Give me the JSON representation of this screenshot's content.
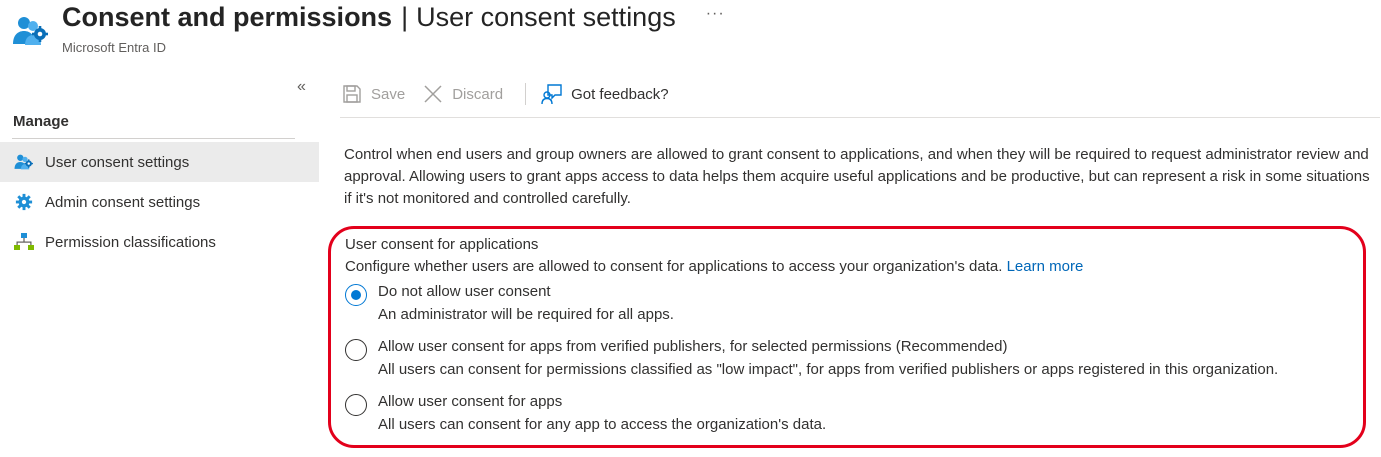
{
  "header": {
    "title_main": "Consent and permissions",
    "title_separator": "|",
    "title_sub": "User consent settings",
    "more": "···",
    "subtitle": "Microsoft Entra ID",
    "icon": "users-gear-icon"
  },
  "sidebar": {
    "collapse": "«",
    "manage_heading": "Manage",
    "items": [
      {
        "label": "User consent settings",
        "icon": "users-gear-icon",
        "active": true
      },
      {
        "label": "Admin consent settings",
        "icon": "gear-icon",
        "active": false
      },
      {
        "label": "Permission classifications",
        "icon": "hierarchy-icon",
        "active": false
      }
    ]
  },
  "toolbar": {
    "save_label": "Save",
    "discard_label": "Discard",
    "feedback_label": "Got feedback?"
  },
  "main": {
    "description": "Control when end users and group owners are allowed to grant consent to applications, and when they will be required to request administrator review and approval. Allowing users to grant apps access to data helps them acquire useful applications and be productive, but can represent a risk in some situations if it's not monitored and controlled carefully.",
    "section_title": "User consent for applications",
    "section_desc": "Configure whether users are allowed to consent for applications to access your organization's data.",
    "learn_more": "Learn more",
    "options": [
      {
        "label": "Do not allow user consent",
        "help": "An administrator will be required for all apps.",
        "checked": true
      },
      {
        "label": "Allow user consent for apps from verified publishers, for selected permissions (Recommended)",
        "help": "All users can consent for permissions classified as \"low impact\", for apps from verified publishers or apps registered in this organization.",
        "checked": false
      },
      {
        "label": "Allow user consent for apps",
        "help": "All users can consent for any app to access the organization's data.",
        "checked": false
      }
    ]
  },
  "colors": {
    "accent": "#0078d4",
    "link": "#0067b8",
    "highlight": "#e3001b",
    "nav_active_bg": "#ebebeb"
  }
}
